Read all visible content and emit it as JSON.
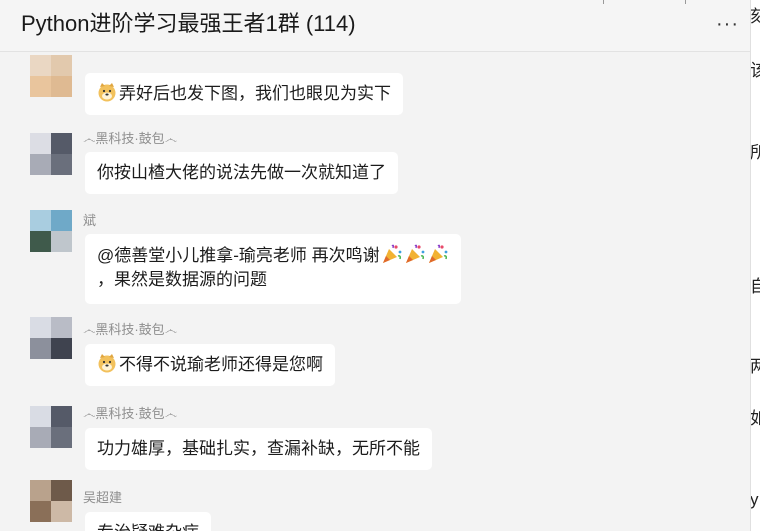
{
  "chat": {
    "title": "Python进阶学习最强王者1群 (114)",
    "more_icon": "more-dots-icon"
  },
  "messages": [
    {
      "sender": "",
      "text": "弄好后也发下图，我们也眼见为实下",
      "emoji": "doge-face-icon"
    },
    {
      "sender": "෴黑科技·鼓包෴",
      "text": "你按山楂大佬的说法先做一次就知道了"
    },
    {
      "sender": "斌",
      "line1": "@德善堂小儿推拿-瑜亮老师 再次鸣谢",
      "line2": "，果然是数据源的问题",
      "emoji": "party-popper-icon"
    },
    {
      "sender": "෴黑科技·鼓包෴",
      "text": "不得不说瑜老师还得是您啊",
      "emoji": "doge-face-icon"
    },
    {
      "sender": "෴黑科技·鼓包෴",
      "text": "功力雄厚，基础扎实，查漏补缺，无所不能"
    },
    {
      "sender": "吴超建",
      "text": "专治疑难杂症"
    }
  ],
  "right_pane": {
    "chars": [
      "刻",
      "该",
      "所",
      "自",
      "两",
      "如",
      "y"
    ]
  }
}
